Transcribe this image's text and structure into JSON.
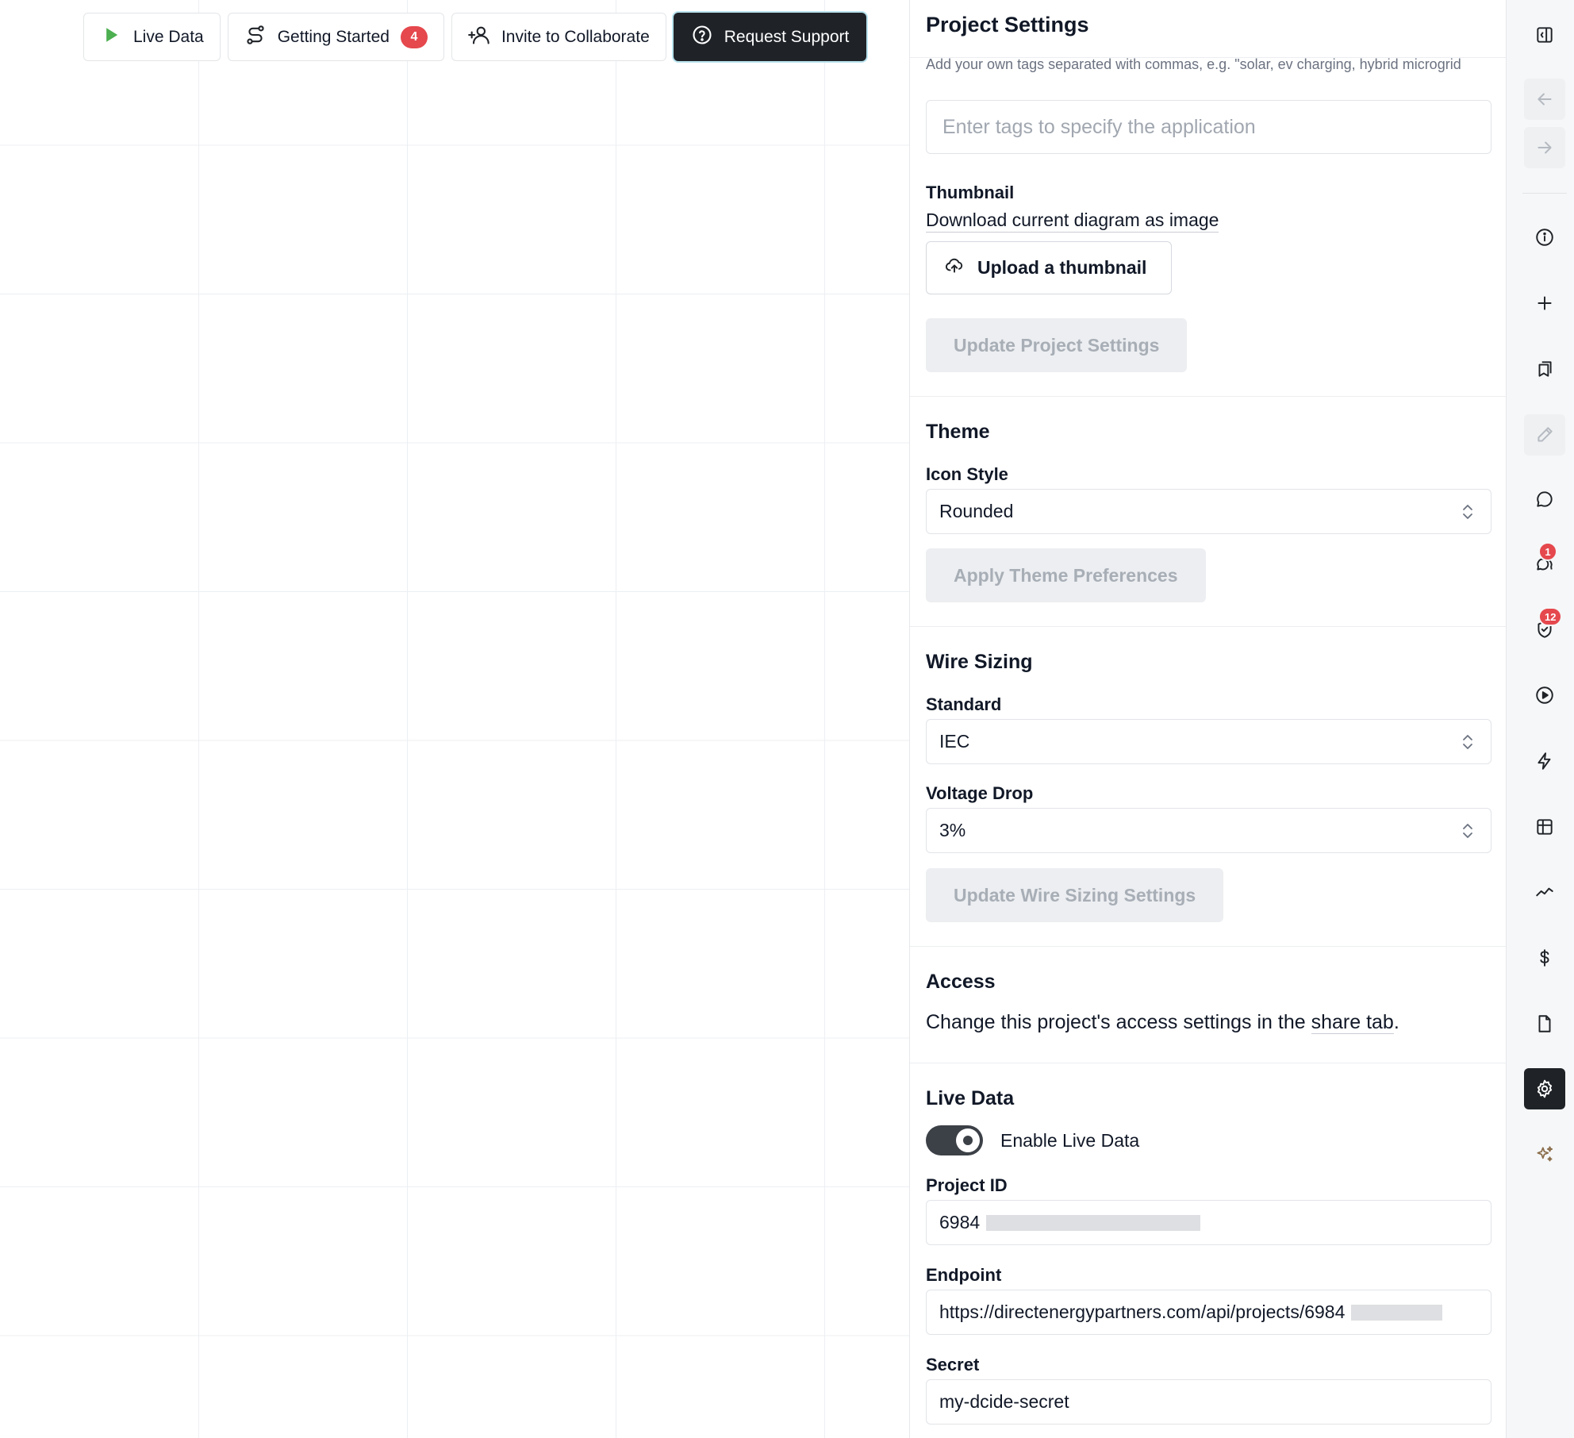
{
  "toolbar": {
    "live_data": "Live Data",
    "getting_started": "Getting Started",
    "getting_started_count": "4",
    "invite": "Invite to Collaborate",
    "request_support": "Request Support"
  },
  "panel": {
    "title": "Project Settings",
    "tags_hint": "Add your own tags separated with commas, e.g. \"solar, ev charging, hybrid microgrid",
    "tags_placeholder": "Enter tags to specify the application",
    "thumbnail_label": "Thumbnail",
    "download_link": "Download current diagram as image",
    "upload_button": "Upload a thumbnail",
    "update_project_button": "Update Project Settings",
    "theme": {
      "title": "Theme",
      "icon_style_label": "Icon Style",
      "icon_style_value": "Rounded",
      "apply_button": "Apply Theme Preferences"
    },
    "wire_sizing": {
      "title": "Wire Sizing",
      "standard_label": "Standard",
      "standard_value": "IEC",
      "voltage_drop_label": "Voltage Drop",
      "voltage_drop_value": "3%",
      "update_button": "Update Wire Sizing Settings"
    },
    "access": {
      "title": "Access",
      "text_before": "Change this project's access settings in the ",
      "link": "share tab",
      "text_after": "."
    },
    "live_data": {
      "title": "Live Data",
      "toggle_label": "Enable Live Data",
      "toggle_on": true,
      "project_id_label": "Project ID",
      "project_id_value": "6984",
      "endpoint_label": "Endpoint",
      "endpoint_value": "https://directenergypartners.com/api/projects/6984",
      "secret_label": "Secret",
      "secret_value": "my-dcide-secret"
    }
  },
  "rail": {
    "icons": [
      "panel-toggle-icon",
      "arrow-left-icon",
      "arrow-right-icon",
      "info-icon",
      "plus-icon",
      "bookmarks-icon",
      "pencil-icon",
      "chat-icon",
      "comments-icon",
      "shield-check-icon",
      "play-circle-icon",
      "lightning-icon",
      "table-icon",
      "trend-line-icon",
      "dollar-icon",
      "document-icon",
      "settings-icon",
      "sparkles-icon"
    ],
    "comments_badge": "1",
    "shield_badge": "12"
  },
  "colors": {
    "accent_dark": "#1f2328",
    "badge_red": "#e5484d",
    "play_green": "#4caf50",
    "sparkle": "#8a6d4b"
  }
}
